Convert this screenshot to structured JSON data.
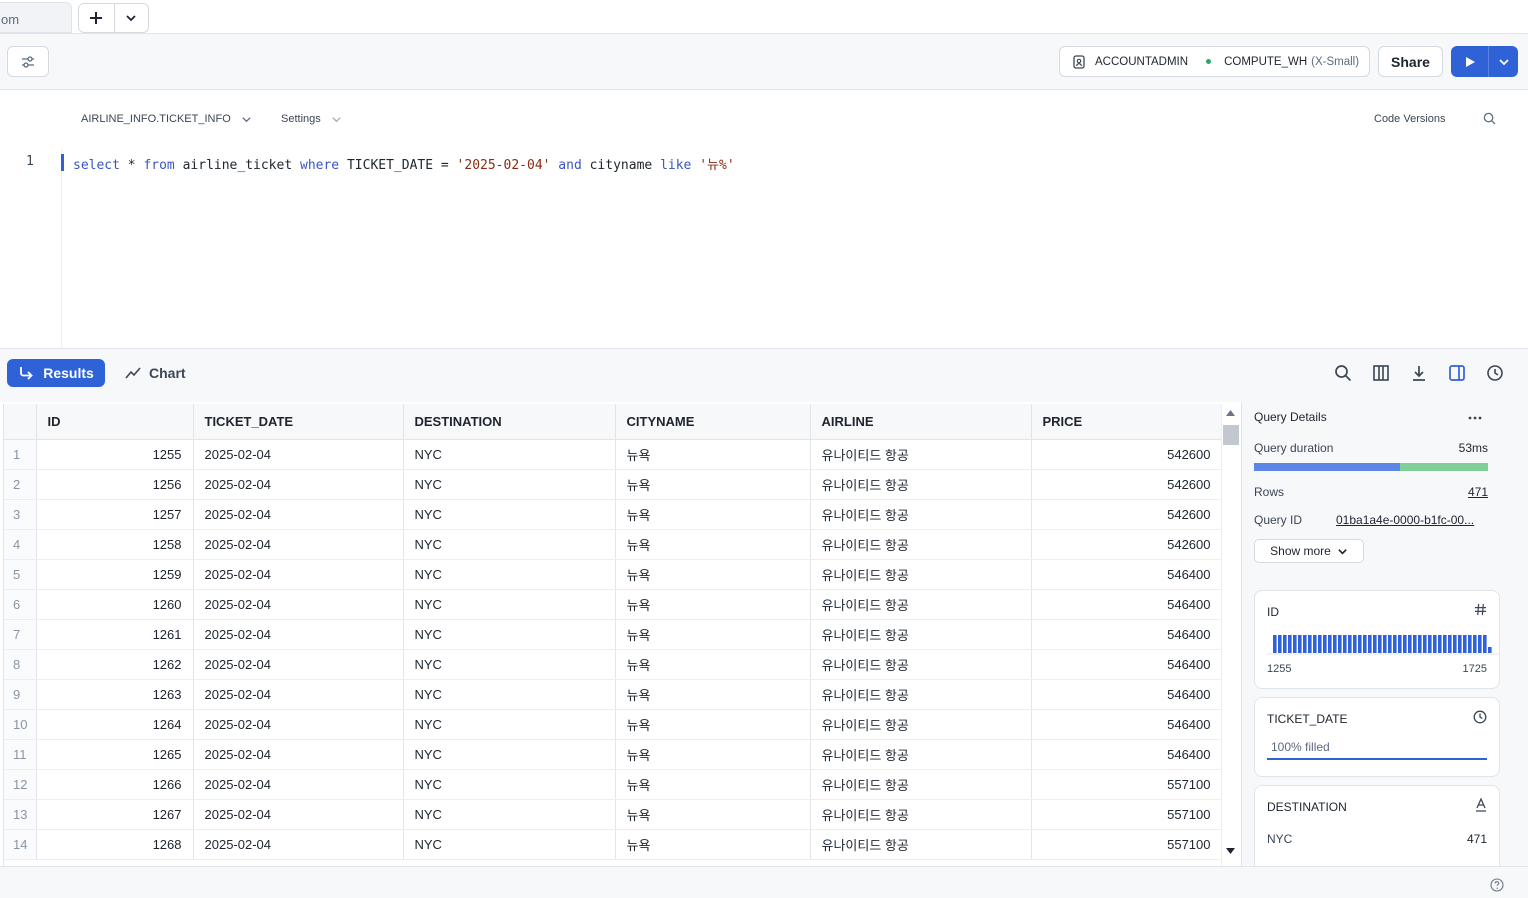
{
  "tabstrip": {
    "partial_tab_label": "om"
  },
  "toolbar": {
    "role": "ACCOUNTADMIN",
    "warehouse": "COMPUTE_WH",
    "warehouse_size": "(X-Small)",
    "share_label": "Share"
  },
  "editor_header": {
    "database_label": "AIRLINE_INFO.TICKET_INFO",
    "settings_label": "Settings",
    "code_versions_label": "Code Versions"
  },
  "editor": {
    "line_number": "1",
    "tokens": {
      "t1": "select",
      "t2": " * ",
      "t3": "from",
      "t4": " airline_ticket ",
      "t5": "where",
      "t6": " TICKET_DATE = ",
      "t7": "'2025-02-04'",
      "t8": " ",
      "t9": "and",
      "t10": " cityname ",
      "t11": "like",
      "t12": " ",
      "t13": "'뉴%'"
    }
  },
  "results_bar": {
    "results_label": "Results",
    "chart_label": "Chart"
  },
  "grid": {
    "columns": [
      "ID",
      "TICKET_DATE",
      "DESTINATION",
      "CITYNAME",
      "AIRLINE",
      "PRICE"
    ],
    "rows": [
      [
        "1",
        "1255",
        "2025-02-04",
        "NYC",
        "뉴욕",
        "유나이티드 항공",
        "542600"
      ],
      [
        "2",
        "1256",
        "2025-02-04",
        "NYC",
        "뉴욕",
        "유나이티드 항공",
        "542600"
      ],
      [
        "3",
        "1257",
        "2025-02-04",
        "NYC",
        "뉴욕",
        "유나이티드 항공",
        "542600"
      ],
      [
        "4",
        "1258",
        "2025-02-04",
        "NYC",
        "뉴욕",
        "유나이티드 항공",
        "542600"
      ],
      [
        "5",
        "1259",
        "2025-02-04",
        "NYC",
        "뉴욕",
        "유나이티드 항공",
        "546400"
      ],
      [
        "6",
        "1260",
        "2025-02-04",
        "NYC",
        "뉴욕",
        "유나이티드 항공",
        "546400"
      ],
      [
        "7",
        "1261",
        "2025-02-04",
        "NYC",
        "뉴욕",
        "유나이티드 항공",
        "546400"
      ],
      [
        "8",
        "1262",
        "2025-02-04",
        "NYC",
        "뉴욕",
        "유나이티드 항공",
        "546400"
      ],
      [
        "9",
        "1263",
        "2025-02-04",
        "NYC",
        "뉴욕",
        "유나이티드 항공",
        "546400"
      ],
      [
        "10",
        "1264",
        "2025-02-04",
        "NYC",
        "뉴욕",
        "유나이티드 항공",
        "546400"
      ],
      [
        "11",
        "1265",
        "2025-02-04",
        "NYC",
        "뉴욕",
        "유나이티드 항공",
        "546400"
      ],
      [
        "12",
        "1266",
        "2025-02-04",
        "NYC",
        "뉴욕",
        "유나이티드 항공",
        "557100"
      ],
      [
        "13",
        "1267",
        "2025-02-04",
        "NYC",
        "뉴욕",
        "유나이티드 항공",
        "557100"
      ],
      [
        "14",
        "1268",
        "2025-02-04",
        "NYC",
        "뉴욕",
        "유나이티드 항공",
        "557100"
      ]
    ]
  },
  "query_details": {
    "title": "Query Details",
    "duration_label": "Query duration",
    "duration_value": "53ms",
    "rows_label": "Rows",
    "rows_value": "471",
    "query_id_label": "Query ID",
    "query_id_value": "01ba1a4e-0000-b1fc-00...",
    "show_more_label": "Show more"
  },
  "columns_panel": {
    "id_card": {
      "title": "ID",
      "min": "1255",
      "max": "1725"
    },
    "ticket_date_card": {
      "title": "TICKET_DATE",
      "filled": "100% filled",
      "filled_fraction": 1.0
    },
    "destination_card": {
      "title": "DESTINATION",
      "top_value": "NYC",
      "top_count": "471"
    }
  },
  "colors": {
    "accent": "#2f62d6",
    "duration_compile": "#5b86e5",
    "duration_exec": "#7fcf97",
    "keyword": "#3a56c4",
    "string": "#8a2a12"
  },
  "icons": [
    "plus-icon",
    "chevron-down-icon",
    "sliders-icon",
    "role-icon",
    "play-icon",
    "search-icon",
    "columns-icon",
    "download-icon",
    "split-panel-icon",
    "history-icon",
    "chart-line-icon",
    "results-arrow-icon",
    "more-icon",
    "hash-icon",
    "clock-icon",
    "text-type-icon",
    "help-icon"
  ]
}
